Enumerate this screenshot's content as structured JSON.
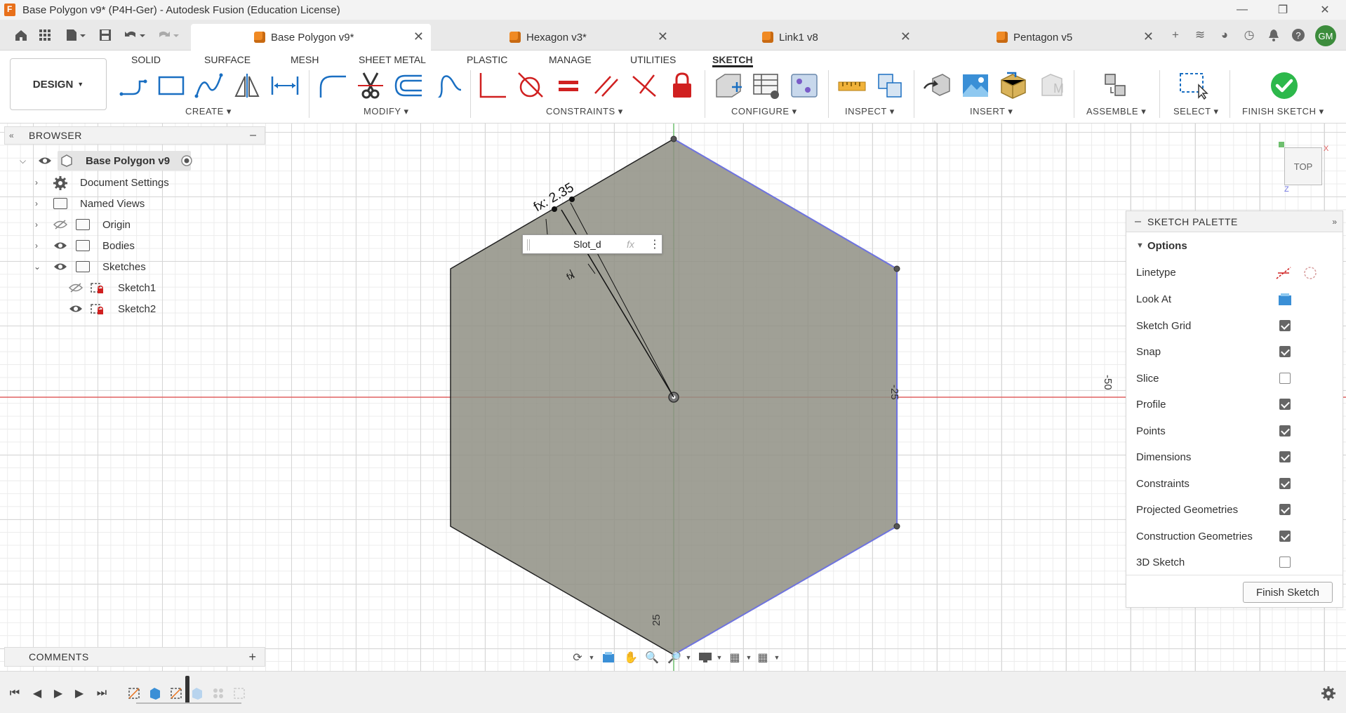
{
  "window": {
    "title": "Base Polygon v9* (P4H-Ger) - Autodesk Fusion (Education License)"
  },
  "tabs": [
    {
      "label": "Base Polygon v9*",
      "active": true
    },
    {
      "label": "Hexagon v3*",
      "active": false
    },
    {
      "label": "Link1 v8",
      "active": false
    },
    {
      "label": "Pentagon v5",
      "active": false
    }
  ],
  "user": {
    "initials": "GM"
  },
  "ribbon": {
    "workspace": "DESIGN",
    "workspace_tabs": [
      "SOLID",
      "SURFACE",
      "MESH",
      "SHEET METAL",
      "PLASTIC",
      "MANAGE",
      "UTILITIES",
      "SKETCH"
    ],
    "groups": [
      "CREATE",
      "MODIFY",
      "CONSTRAINTS",
      "CONFIGURE",
      "INSPECT",
      "INSERT",
      "ASSEMBLE",
      "SELECT",
      "FINISH SKETCH"
    ]
  },
  "browser": {
    "title": "BROWSER",
    "root": "Base Polygon v9",
    "items": [
      {
        "label": "Document Settings"
      },
      {
        "label": "Named Views"
      },
      {
        "label": "Origin"
      },
      {
        "label": "Bodies"
      },
      {
        "label": "Sketches"
      },
      {
        "label": "Sketch1"
      },
      {
        "label": "Sketch2"
      }
    ]
  },
  "palette": {
    "title": "SKETCH PALETTE",
    "section": "Options",
    "rows": [
      {
        "label": "Linetype",
        "kind": "icons"
      },
      {
        "label": "Look At",
        "kind": "icon"
      },
      {
        "label": "Sketch Grid",
        "checked": true
      },
      {
        "label": "Snap",
        "checked": true
      },
      {
        "label": "Slice",
        "checked": false
      },
      {
        "label": "Profile",
        "checked": true
      },
      {
        "label": "Points",
        "checked": true
      },
      {
        "label": "Dimensions",
        "checked": true
      },
      {
        "label": "Constraints",
        "checked": true
      },
      {
        "label": "Projected Geometries",
        "checked": true
      },
      {
        "label": "Construction Geometries",
        "checked": true
      },
      {
        "label": "3D Sketch",
        "checked": false
      }
    ],
    "finish_button": "Finish Sketch"
  },
  "sketch": {
    "dim_main": "fx: 2.35",
    "dim_small": "fx",
    "dim_input_value": "Slot_d",
    "dim_input_fx": "fx",
    "label_right": "-25",
    "label_bottom": "25",
    "label_far_right": "-50"
  },
  "viewcube": {
    "face": "TOP"
  },
  "comments": {
    "title": "COMMENTS"
  },
  "colors": {
    "profile_fill": "#8f8f84",
    "x_axis": "#e06060",
    "y_axis": "#6fbf6f",
    "finish_green": "#2db84b",
    "accent_orange": "#f08a24"
  }
}
